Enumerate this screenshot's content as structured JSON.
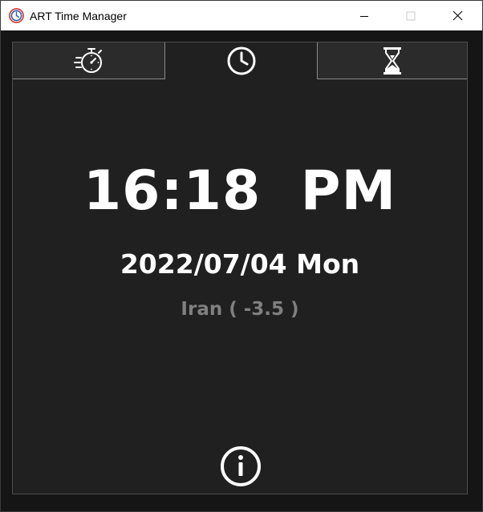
{
  "window": {
    "title": "ART Time Manager"
  },
  "tabs": [
    {
      "name": "stopwatch",
      "icon": "stopwatch-icon",
      "active": false
    },
    {
      "name": "clock",
      "icon": "clock-icon",
      "active": true
    },
    {
      "name": "timer",
      "icon": "hourglass-icon",
      "active": false
    }
  ],
  "clock": {
    "time": "16:18  PM",
    "date": "2022/07/04 Mon",
    "timezone": "Iran ( -3.5 )"
  },
  "footer": {
    "info_icon": "info-icon"
  },
  "colors": {
    "background": "#202020",
    "text_primary": "#ffffff",
    "text_secondary": "#808080",
    "app_icon_ring": "#d23a3a",
    "app_icon_face": "#2a5db0"
  }
}
